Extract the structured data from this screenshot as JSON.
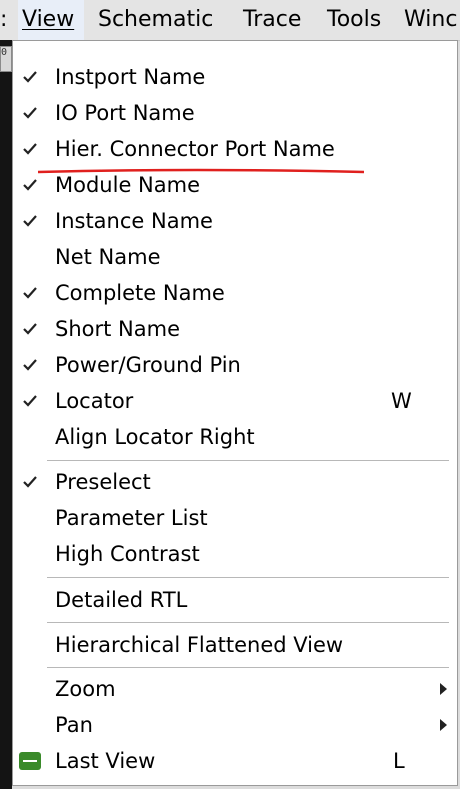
{
  "menubar": {
    "items": [
      {
        "label": ":"
      },
      {
        "label": "View"
      },
      {
        "label": "Schematic"
      },
      {
        "label": "Trace"
      },
      {
        "label": "Tools"
      },
      {
        "label": "Winc"
      }
    ]
  },
  "toolbar": {
    "icon_text": "0"
  },
  "view_menu": {
    "items": [
      {
        "label": "Instport Name",
        "checked": true
      },
      {
        "label": "IO Port Name",
        "checked": true
      },
      {
        "label": "Hier. Connector Port Name",
        "checked": true
      },
      {
        "label": "Module Name",
        "checked": true
      },
      {
        "label": "Instance Name",
        "checked": true
      },
      {
        "label": "Net Name",
        "checked": false
      },
      {
        "label": "Complete Name",
        "checked": true
      },
      {
        "label": "Short Name",
        "checked": true
      },
      {
        "label": "Power/Ground Pin",
        "checked": true
      },
      {
        "label": "Locator",
        "checked": true,
        "shortcut": "W"
      },
      {
        "label": "Align Locator Right",
        "checked": false
      },
      {
        "label": "Preselect",
        "checked": true
      },
      {
        "label": "Parameter List",
        "checked": false
      },
      {
        "label": "High Contrast",
        "checked": false
      },
      {
        "label": "Detailed RTL",
        "checked": false
      },
      {
        "label": "Hierarchical Flattened View",
        "checked": false
      },
      {
        "label": "Zoom",
        "submenu": true
      },
      {
        "label": "Pan",
        "submenu": true
      },
      {
        "label": "Last View",
        "shortcut": "L",
        "icon": "back-arrow-icon"
      }
    ]
  },
  "colors": {
    "annotation": "#e0201e",
    "active_menu": "#e8eef8"
  }
}
